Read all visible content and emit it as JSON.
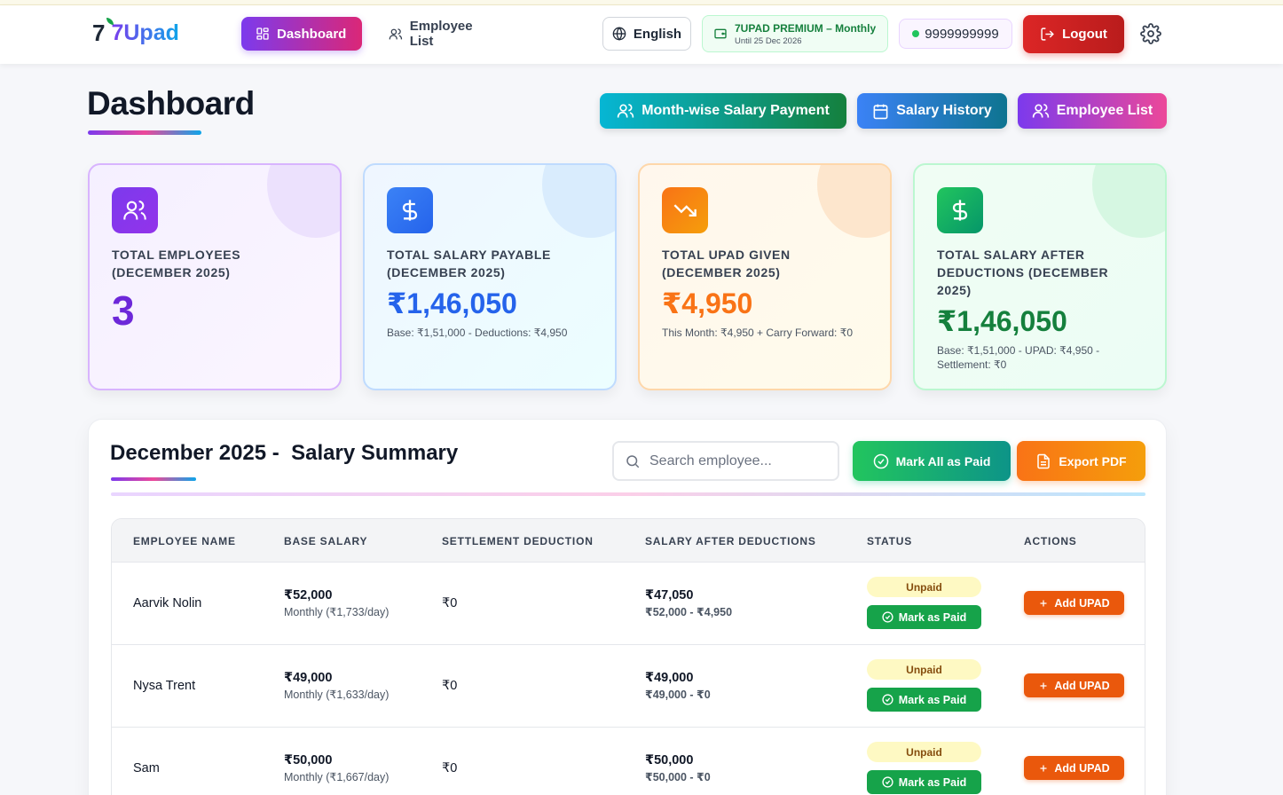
{
  "header": {
    "logo_mark": "7",
    "logo_text": "7Upad",
    "nav": {
      "dashboard": "Dashboard",
      "employee_list": "Employee List"
    },
    "language": "English",
    "plan": {
      "title": "7UPAD PREMIUM – Monthly",
      "valid_until": "Until 25 Dec 2026"
    },
    "phone": "9999999999",
    "logout": "Logout"
  },
  "page": {
    "title": "Dashboard",
    "actions": {
      "monthwise": "Month-wise Salary Payment",
      "history": "Salary History",
      "employee_list": "Employee List"
    }
  },
  "cards": [
    {
      "label": "TOTAL EMPLOYEES (DECEMBER 2025)",
      "value": "3",
      "sub": ""
    },
    {
      "label": "TOTAL SALARY PAYABLE (DECEMBER 2025)",
      "value": "₹1,46,050",
      "sub": "Base: ₹1,51,000 - Deductions: ₹4,950"
    },
    {
      "label": "TOTAL UPAD GIVEN (DECEMBER 2025)",
      "value": "₹4,950",
      "sub": "This Month: ₹4,950 + Carry Forward: ₹0"
    },
    {
      "label": "TOTAL SALARY AFTER DEDUCTIONS (DECEMBER 2025)",
      "value": "₹1,46,050",
      "sub": "Base: ₹1,51,000 - UPAD: ₹4,950 - Settlement: ₹0"
    }
  ],
  "summary": {
    "title": "December 2025 -  Salary Summary",
    "search_placeholder": "Search employee...",
    "mark_all": "Mark All as Paid",
    "export": "Export PDF",
    "columns": [
      "EMPLOYEE NAME",
      "BASE SALARY",
      "SETTLEMENT DEDUCTION",
      "SALARY AFTER DEDUCTIONS",
      "STATUS",
      "ACTIONS"
    ],
    "rows": [
      {
        "name": "Aarvik Nolin",
        "base": "₹52,000",
        "base_sub": "Monthly (₹1,733/day)",
        "settlement": "₹0",
        "after": "₹47,050",
        "after_sub": "₹52,000 - ₹4,950",
        "status": "Unpaid",
        "mark_paid": "Mark as Paid",
        "add_upad": "Add UPAD"
      },
      {
        "name": "Nysa Trent",
        "base": "₹49,000",
        "base_sub": "Monthly (₹1,633/day)",
        "settlement": "₹0",
        "after": "₹49,000",
        "after_sub": "₹49,000 - ₹0",
        "status": "Unpaid",
        "mark_paid": "Mark as Paid",
        "add_upad": "Add UPAD"
      },
      {
        "name": "Sam",
        "base": "₹50,000",
        "base_sub": "Monthly (₹1,667/day)",
        "settlement": "₹0",
        "after": "₹50,000",
        "after_sub": "₹50,000 - ₹0",
        "status": "Unpaid",
        "mark_paid": "Mark as Paid",
        "add_upad": "Add UPAD"
      }
    ]
  }
}
